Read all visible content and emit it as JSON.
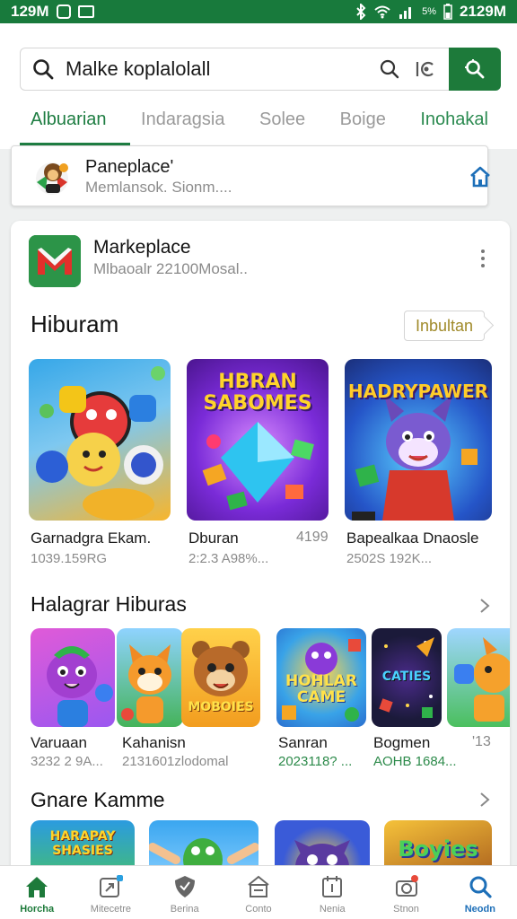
{
  "status_bar": {
    "time_left": "129M",
    "time_right": "2129M",
    "battery": "5%"
  },
  "search": {
    "query": "Malke koplalolall"
  },
  "tabs": [
    {
      "label": "Albuarian",
      "active": true
    },
    {
      "label": "Indaragsia",
      "active": false
    },
    {
      "label": "Solee",
      "active": false
    },
    {
      "label": "Boige",
      "active": false
    },
    {
      "label": "Inohakal",
      "active": false
    }
  ],
  "page_card": {
    "title": "Paneplace'",
    "subtitle": "Memlansok. Sionm...."
  },
  "app_header": {
    "title": "Markeplace",
    "meta": "Mlbaoalr 22100Mosal.."
  },
  "section1": {
    "title": "Hiburam",
    "action": "Inbultan",
    "items": [
      {
        "name": "Garnadgra Ekam.",
        "meta": "1039.159RG",
        "number": "",
        "art_text": ""
      },
      {
        "name": "Dburan",
        "meta": "2:2.3 A98%...",
        "number": "4199",
        "art_text": "HBRAN SABOMES"
      },
      {
        "name": "Bapealkaa Dnaosle",
        "meta": "2502S 192K...",
        "number": "",
        "art_text": "HADRYPAWER"
      }
    ]
  },
  "section2": {
    "title": "Halagrar Hiburas",
    "items": [
      {
        "name": "Varuaan",
        "meta": "3232 2 9A...",
        "art_text": ""
      },
      {
        "name": "Kahanisn",
        "meta": "2131601zlodomal",
        "art_text": "MOBOIES"
      },
      {
        "name": "Sanran",
        "meta": "2023118? ...",
        "art_text": "HOHLAR CAME"
      },
      {
        "name": "Bogmen",
        "meta": "AOHB 1684...",
        "art_text": "CATIES"
      },
      {
        "name": "",
        "meta": "",
        "art_text": "",
        "number": "'13"
      }
    ]
  },
  "section3": {
    "title": "Gnare Kamme",
    "items": [
      {
        "art_text": "HARAPAY SHASIES"
      },
      {
        "art_text": ""
      },
      {
        "art_text": ""
      },
      {
        "art_text": "Boyies"
      }
    ]
  },
  "bottom_nav": [
    {
      "label": "Horcha",
      "icon": "home-icon",
      "state": "active"
    },
    {
      "label": "Mitecetre",
      "icon": "apps-icon",
      "state": "normal"
    },
    {
      "label": "Berina",
      "icon": "shield-icon",
      "state": "normal"
    },
    {
      "label": "Conto",
      "icon": "store-icon",
      "state": "normal"
    },
    {
      "label": "Nenia",
      "icon": "calendar-icon",
      "state": "normal"
    },
    {
      "label": "Stnon",
      "icon": "camera-icon",
      "state": "normal"
    },
    {
      "label": "Neodn",
      "icon": "search-icon",
      "state": "accent"
    }
  ],
  "colors": {
    "brand_green": "#1d7a3a",
    "accent_blue": "#1d6fb8"
  }
}
